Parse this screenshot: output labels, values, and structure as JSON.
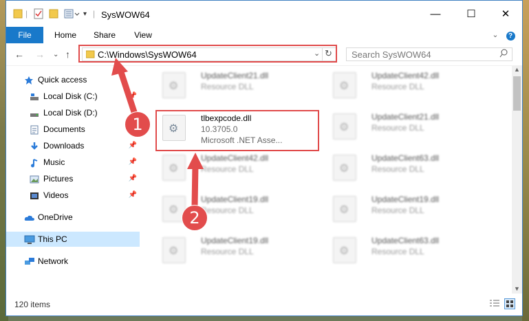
{
  "window": {
    "title": "SysWOW64",
    "minimize_glyph": "—",
    "maximize_glyph": "☐",
    "close_glyph": "✕"
  },
  "ribbon": {
    "tabs": [
      {
        "label": "File"
      },
      {
        "label": "Home"
      },
      {
        "label": "Share"
      },
      {
        "label": "View"
      }
    ],
    "help_glyph": "?"
  },
  "address": {
    "path": "C:\\Windows\\SysWOW64",
    "search_placeholder": "Search SysWOW64"
  },
  "nav": {
    "quick_access": "Quick access",
    "items": [
      {
        "label": "Local Disk (C:)",
        "icon": "disk-icon",
        "pinned": true
      },
      {
        "label": "Local Disk (D:)",
        "icon": "disk-icon",
        "pinned": false
      },
      {
        "label": "Documents",
        "icon": "documents-icon",
        "pinned": true
      },
      {
        "label": "Downloads",
        "icon": "download-icon",
        "pinned": true
      },
      {
        "label": "Music",
        "icon": "music-icon",
        "pinned": true
      },
      {
        "label": "Pictures",
        "icon": "pictures-icon",
        "pinned": true
      },
      {
        "label": "Videos",
        "icon": "videos-icon",
        "pinned": true
      }
    ],
    "onedrive": "OneDrive",
    "thispc": "This PC",
    "network": "Network"
  },
  "files": [
    {
      "name": "UpdateClient21.dll",
      "desc": "Resource DLL"
    },
    {
      "name": "UpdateClient42.dll",
      "desc": "Resource DLL"
    },
    {
      "name": "tlbexpcode.dll",
      "desc": "10.3705.0",
      "desc2": "Microsoft .NET Asse..."
    },
    {
      "name": "UpdateClient21.dll",
      "desc": "Resource DLL"
    },
    {
      "name": "UpdateClient42.dll",
      "desc": "Resource DLL"
    },
    {
      "name": "UpdateClient63.dll",
      "desc": "Resource DLL"
    },
    {
      "name": "UpdateClient19.dll",
      "desc": "Resource DLL"
    },
    {
      "name": "UpdateClient19.dll",
      "desc": "Resource DLL"
    },
    {
      "name": "UpdateClient19.dll",
      "desc": "Resource DLL"
    },
    {
      "name": "UpdateClient63.dll",
      "desc": "Resource DLL"
    }
  ],
  "status": {
    "count": "120 items"
  },
  "callouts": {
    "one": "1",
    "two": "2"
  },
  "colors": {
    "accent": "#1979ca",
    "highlight": "#e04a4a"
  }
}
